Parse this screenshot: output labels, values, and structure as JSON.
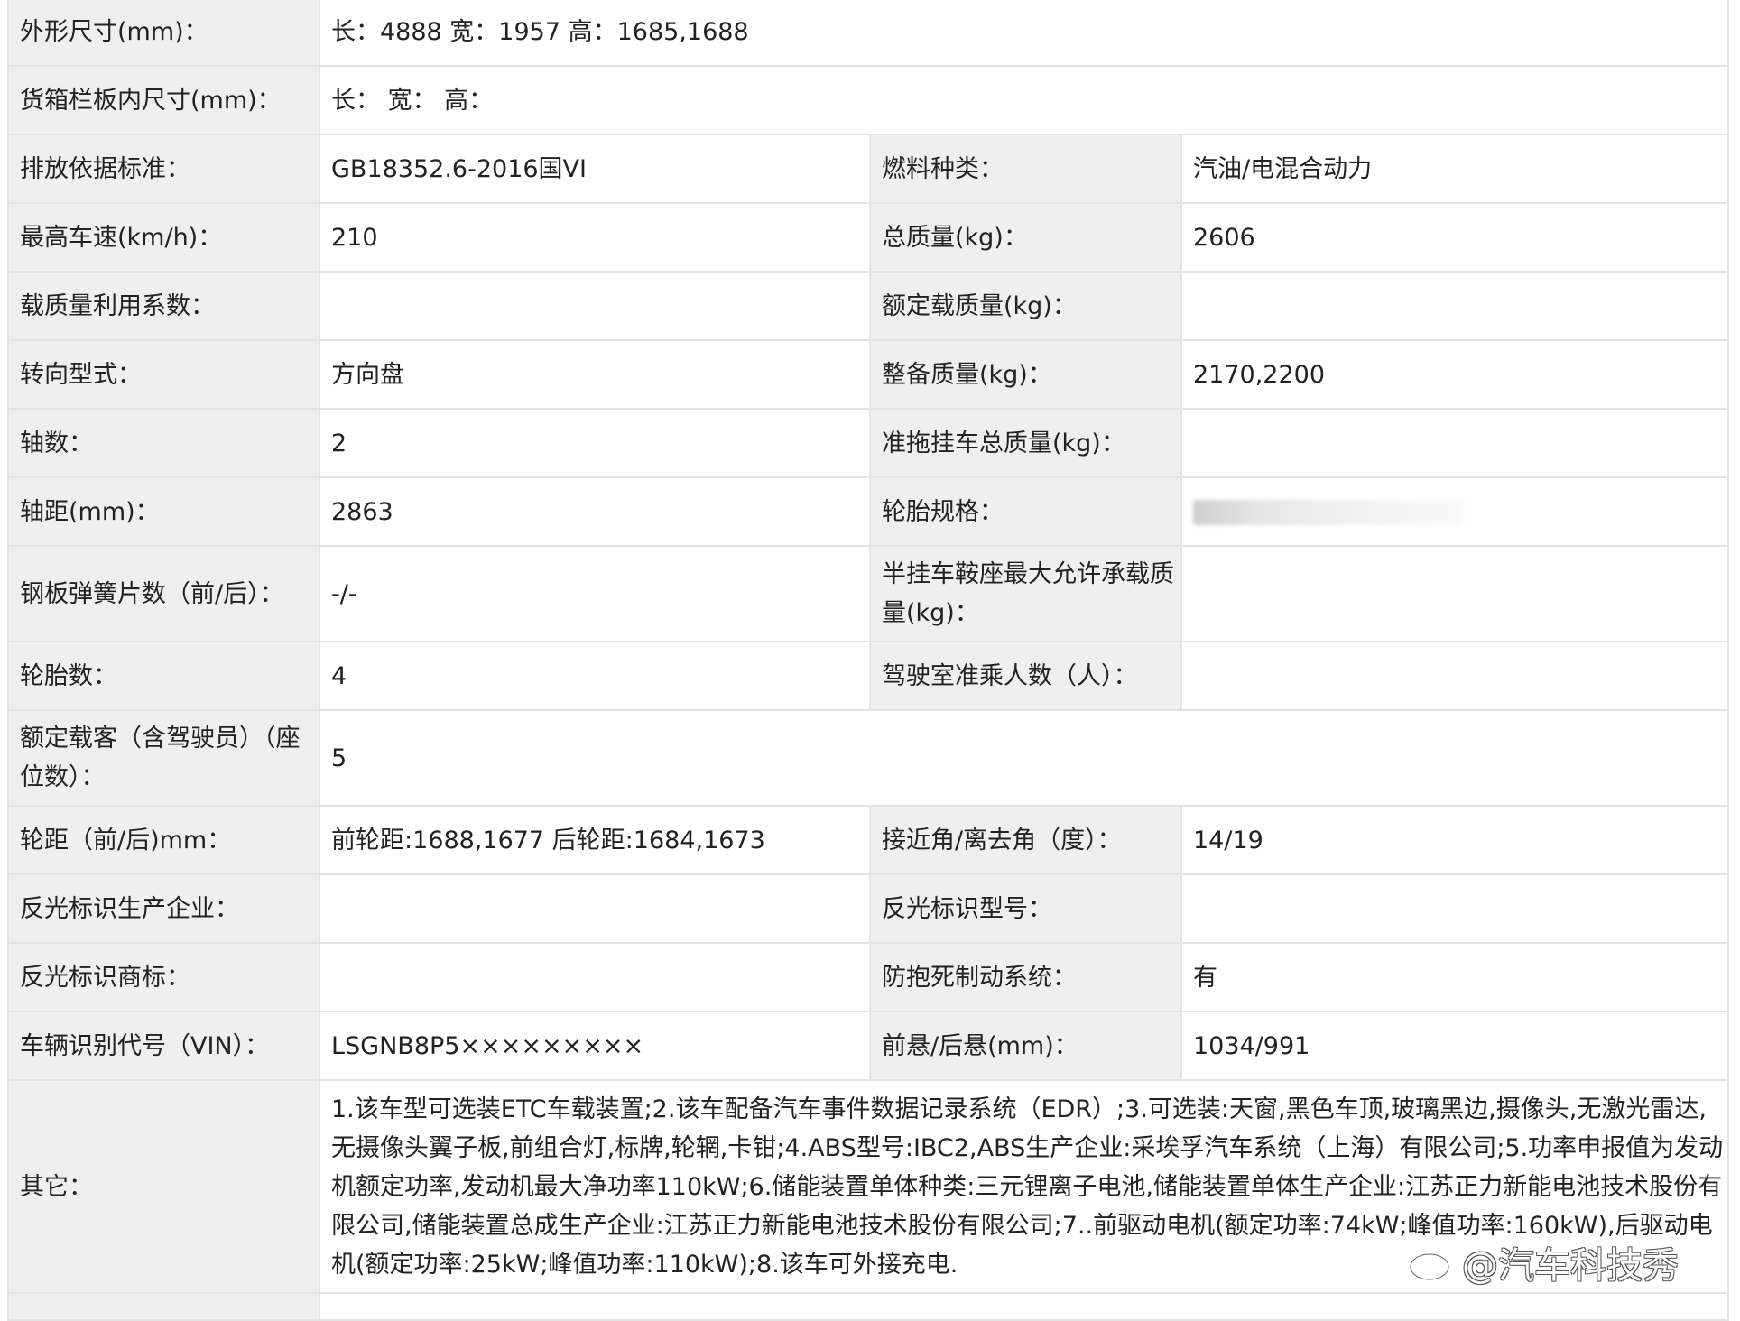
{
  "rows": [
    {
      "l1": "外形尺寸(mm)：",
      "v1": "长：4888 宽：1957 高：1685,1688"
    },
    {
      "l1": "货箱栏板内尺寸(mm)：",
      "v1": "长：  宽：  高："
    },
    {
      "l1": "排放依据标准：",
      "v1": "GB18352.6-2016国VI",
      "l2": "燃料种类：",
      "v2": "汽油/电混合动力"
    },
    {
      "l1": "最高车速(km/h)：",
      "v1": "210",
      "l2": "总质量(kg)：",
      "v2": "2606"
    },
    {
      "l1": "载质量利用系数：",
      "v1": "",
      "l2": "额定载质量(kg)：",
      "v2": ""
    },
    {
      "l1": "转向型式：",
      "v1": "方向盘",
      "l2": "整备质量(kg)：",
      "v2": "2170,2200"
    },
    {
      "l1": "轴数：",
      "v1": "2",
      "l2": "准拖挂车总质量(kg)：",
      "v2": ""
    },
    {
      "l1": "轴距(mm)：",
      "v1": "2863",
      "l2": "轮胎规格：",
      "v2": ""
    },
    {
      "l1": "钢板弹簧片数（前/后）：",
      "v1": "-/-",
      "l2": "半挂车鞍座最大允许承载质量(kg)：",
      "v2": ""
    },
    {
      "l1": "轮胎数：",
      "v1": "4",
      "l2": "驾驶室准乘人数（人）：",
      "v2": ""
    },
    {
      "l1": "额定载客（含驾驶员）（座位数）：",
      "v1": "5"
    },
    {
      "l1": "轮距（前/后)mm：",
      "v1": "前轮距:1688,1677 后轮距:1684,1673",
      "l2": "接近角/离去角（度）：",
      "v2": "14/19"
    },
    {
      "l1": "反光标识生产企业：",
      "v1": "",
      "l2": "反光标识型号：",
      "v2": ""
    },
    {
      "l1": "反光标识商标：",
      "v1": "",
      "l2": "防抱死制动系统：",
      "v2": "有"
    },
    {
      "l1": "车辆识别代号（VIN）：",
      "v1": "LSGNB8P5×××××××××",
      "l2": "前悬/后悬(mm)：",
      "v2": "1034/991"
    },
    {
      "l1": "其它：",
      "v1": "1.该车型可选装ETC车载装置;2.该车配备汽车事件数据记录系统（EDR）;3.可选装:天窗,黑色车顶,玻璃黑边,摄像头,无激光雷达,无摄像头翼子板,前组合灯,标牌,轮辋,卡钳;4.ABS型号:IBC2,ABS生产企业:采埃孚汽车系统（上海）有限公司;5.功率申报值为发动机额定功率,发动机最大净功率110kW;6.储能装置单体种类:三元锂离子电池,储能装置单体生产企业:江苏正力新能电池技术股份有限公司,储能装置总成生产企业:江苏正力新能电池技术股份有限公司;7..前驱动电机(额定功率:74kW;峰值功率:160kW),后驱动电机(额定功率:25kW;峰值功率:110kW);8.该车可外接充电."
    }
  ],
  "watermark": {
    "text": "@汽车科技秀",
    "icon": "weibo-logo-icon"
  }
}
